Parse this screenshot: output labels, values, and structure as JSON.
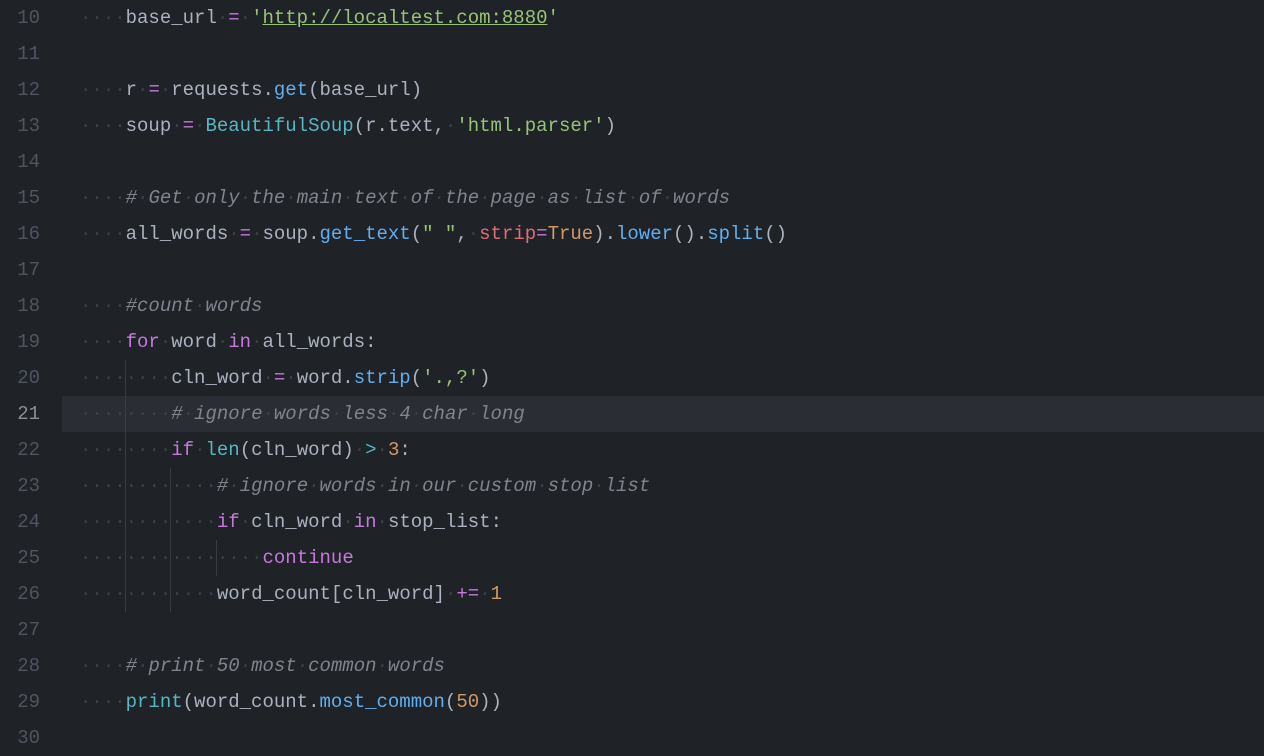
{
  "editor": {
    "first_line_number": 10,
    "current_line_number": 21,
    "lines": [
      {
        "n": 10,
        "indent": 1,
        "tokens": [
          {
            "t": "base_url",
            "c": "c-def"
          },
          {
            "t": " ",
            "c": "ws"
          },
          {
            "t": "=",
            "c": "c-assign"
          },
          {
            "t": " ",
            "c": "ws"
          },
          {
            "t": "'",
            "c": "c-str"
          },
          {
            "t": "http://localtest.com:8880",
            "c": "c-url"
          },
          {
            "t": "'",
            "c": "c-str"
          }
        ]
      },
      {
        "n": 11,
        "indent": 0,
        "tokens": []
      },
      {
        "n": 12,
        "indent": 1,
        "tokens": [
          {
            "t": "r",
            "c": "c-def"
          },
          {
            "t": " ",
            "c": "ws"
          },
          {
            "t": "=",
            "c": "c-assign"
          },
          {
            "t": " ",
            "c": "ws"
          },
          {
            "t": "requests",
            "c": "c-def"
          },
          {
            "t": ".",
            "c": "c-op"
          },
          {
            "t": "get",
            "c": "c-func"
          },
          {
            "t": "(",
            "c": "c-op"
          },
          {
            "t": "base_url",
            "c": "c-def"
          },
          {
            "t": ")",
            "c": "c-op"
          }
        ]
      },
      {
        "n": 13,
        "indent": 1,
        "tokens": [
          {
            "t": "soup",
            "c": "c-def"
          },
          {
            "t": " ",
            "c": "ws"
          },
          {
            "t": "=",
            "c": "c-assign"
          },
          {
            "t": " ",
            "c": "ws"
          },
          {
            "t": "BeautifulSoup",
            "c": "c-funcdef"
          },
          {
            "t": "(",
            "c": "c-op"
          },
          {
            "t": "r",
            "c": "c-def"
          },
          {
            "t": ".",
            "c": "c-op"
          },
          {
            "t": "text",
            "c": "c-def"
          },
          {
            "t": ",",
            "c": "c-op"
          },
          {
            "t": " ",
            "c": "ws"
          },
          {
            "t": "'html.parser'",
            "c": "c-str"
          },
          {
            "t": ")",
            "c": "c-op"
          }
        ]
      },
      {
        "n": 14,
        "indent": 0,
        "tokens": []
      },
      {
        "n": 15,
        "indent": 1,
        "tokens": [
          {
            "t": "# Get only the main text of the page as list of words",
            "c": "c-comment2",
            "ws": true
          }
        ]
      },
      {
        "n": 16,
        "indent": 1,
        "tokens": [
          {
            "t": "all_words",
            "c": "c-def"
          },
          {
            "t": " ",
            "c": "ws"
          },
          {
            "t": "=",
            "c": "c-assign"
          },
          {
            "t": " ",
            "c": "ws"
          },
          {
            "t": "soup",
            "c": "c-def"
          },
          {
            "t": ".",
            "c": "c-op"
          },
          {
            "t": "get_text",
            "c": "c-func"
          },
          {
            "t": "(",
            "c": "c-op"
          },
          {
            "t": "\" \"",
            "c": "c-str"
          },
          {
            "t": ",",
            "c": "c-op"
          },
          {
            "t": " ",
            "c": "ws"
          },
          {
            "t": "strip",
            "c": "c-param"
          },
          {
            "t": "=",
            "c": "c-assign"
          },
          {
            "t": "True",
            "c": "c-const"
          },
          {
            "t": ")",
            "c": "c-op"
          },
          {
            "t": ".",
            "c": "c-op"
          },
          {
            "t": "lower",
            "c": "c-func"
          },
          {
            "t": "()",
            "c": "c-op"
          },
          {
            "t": ".",
            "c": "c-op"
          },
          {
            "t": "split",
            "c": "c-func"
          },
          {
            "t": "()",
            "c": "c-op"
          }
        ]
      },
      {
        "n": 17,
        "indent": 0,
        "tokens": []
      },
      {
        "n": 18,
        "indent": 1,
        "tokens": [
          {
            "t": "#count words",
            "c": "c-comment2",
            "ws": true
          }
        ]
      },
      {
        "n": 19,
        "indent": 1,
        "tokens": [
          {
            "t": "for",
            "c": "c-kw"
          },
          {
            "t": " ",
            "c": "ws"
          },
          {
            "t": "word",
            "c": "c-def"
          },
          {
            "t": " ",
            "c": "ws"
          },
          {
            "t": "in",
            "c": "c-kw"
          },
          {
            "t": " ",
            "c": "ws"
          },
          {
            "t": "all_words",
            "c": "c-def"
          },
          {
            "t": ":",
            "c": "c-op"
          }
        ]
      },
      {
        "n": 20,
        "indent": 2,
        "guides": [
          1
        ],
        "tokens": [
          {
            "t": "cln_word",
            "c": "c-def"
          },
          {
            "t": " ",
            "c": "ws"
          },
          {
            "t": "=",
            "c": "c-assign"
          },
          {
            "t": " ",
            "c": "ws"
          },
          {
            "t": "word",
            "c": "c-def"
          },
          {
            "t": ".",
            "c": "c-op"
          },
          {
            "t": "strip",
            "c": "c-func"
          },
          {
            "t": "(",
            "c": "c-op"
          },
          {
            "t": "'.,?'",
            "c": "c-str"
          },
          {
            "t": ")",
            "c": "c-op"
          }
        ]
      },
      {
        "n": 21,
        "indent": 2,
        "guides": [
          1
        ],
        "current": true,
        "tokens": [
          {
            "t": "# ignore words less 4 char long",
            "c": "c-comment2",
            "ws": true
          }
        ]
      },
      {
        "n": 22,
        "indent": 2,
        "guides": [
          1
        ],
        "tokens": [
          {
            "t": "if",
            "c": "c-kw"
          },
          {
            "t": " ",
            "c": "ws"
          },
          {
            "t": "len",
            "c": "c-funcdef"
          },
          {
            "t": "(",
            "c": "c-op"
          },
          {
            "t": "cln_word",
            "c": "c-def"
          },
          {
            "t": ")",
            "c": "c-op"
          },
          {
            "t": " ",
            "c": "ws"
          },
          {
            "t": ">",
            "c": "c-funcdef"
          },
          {
            "t": " ",
            "c": "ws"
          },
          {
            "t": "3",
            "c": "c-num"
          },
          {
            "t": ":",
            "c": "c-op"
          }
        ]
      },
      {
        "n": 23,
        "indent": 3,
        "guides": [
          1,
          2
        ],
        "tokens": [
          {
            "t": "# ignore words in our custom stop list",
            "c": "c-comment2",
            "ws": true
          }
        ]
      },
      {
        "n": 24,
        "indent": 3,
        "guides": [
          1,
          2
        ],
        "tokens": [
          {
            "t": "if",
            "c": "c-kw"
          },
          {
            "t": " ",
            "c": "ws"
          },
          {
            "t": "cln_word",
            "c": "c-def"
          },
          {
            "t": " ",
            "c": "ws"
          },
          {
            "t": "in",
            "c": "c-kw"
          },
          {
            "t": " ",
            "c": "ws"
          },
          {
            "t": "stop_list",
            "c": "c-def"
          },
          {
            "t": ":",
            "c": "c-op"
          }
        ]
      },
      {
        "n": 25,
        "indent": 4,
        "guides": [
          1,
          2,
          3
        ],
        "tokens": [
          {
            "t": "continue",
            "c": "c-kw"
          }
        ]
      },
      {
        "n": 26,
        "indent": 3,
        "guides": [
          1,
          2
        ],
        "tokens": [
          {
            "t": "word_count",
            "c": "c-def"
          },
          {
            "t": "[",
            "c": "c-op"
          },
          {
            "t": "cln_word",
            "c": "c-def"
          },
          {
            "t": "]",
            "c": "c-op"
          },
          {
            "t": " ",
            "c": "ws"
          },
          {
            "t": "+=",
            "c": "c-assign"
          },
          {
            "t": " ",
            "c": "ws"
          },
          {
            "t": "1",
            "c": "c-num"
          }
        ]
      },
      {
        "n": 27,
        "indent": 0,
        "tokens": []
      },
      {
        "n": 28,
        "indent": 1,
        "tokens": [
          {
            "t": "# print 50 most common words",
            "c": "c-comment2",
            "ws": true
          }
        ]
      },
      {
        "n": 29,
        "indent": 1,
        "tokens": [
          {
            "t": "print",
            "c": "c-funcdef"
          },
          {
            "t": "(",
            "c": "c-op"
          },
          {
            "t": "word_count",
            "c": "c-def"
          },
          {
            "t": ".",
            "c": "c-op"
          },
          {
            "t": "most_common",
            "c": "c-func"
          },
          {
            "t": "(",
            "c": "c-op"
          },
          {
            "t": "50",
            "c": "c-num"
          },
          {
            "t": ")",
            "c": "c-op"
          },
          {
            "t": ")",
            "c": "c-op"
          }
        ]
      },
      {
        "n": 30,
        "indent": 0,
        "tokens": []
      }
    ]
  }
}
